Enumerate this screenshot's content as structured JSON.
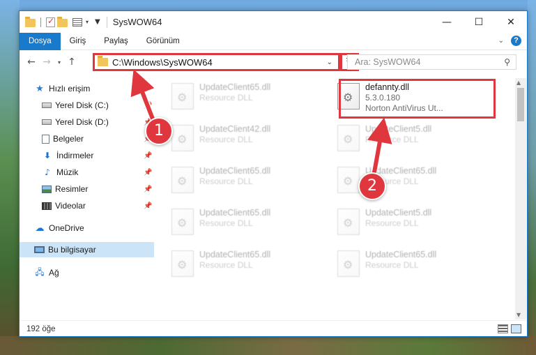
{
  "window": {
    "title": "SysWOW64",
    "controls": {
      "minimize": "—",
      "maximize": "☐",
      "close": "✕"
    }
  },
  "ribbon": {
    "tabs": [
      {
        "label": "Dosya",
        "active": true
      },
      {
        "label": "Giriş"
      },
      {
        "label": "Paylaş"
      },
      {
        "label": "Görünüm"
      }
    ],
    "help": "?"
  },
  "navigation": {
    "address": "C:\\Windows\\SysWOW64",
    "search_placeholder": "Ara: SysWOW64"
  },
  "sidebar": {
    "items": [
      {
        "label": "Hızlı erişim",
        "icon": "star-icon"
      },
      {
        "label": "Yerel Disk (C:)",
        "icon": "drive-icon",
        "pinned": true
      },
      {
        "label": "Yerel Disk (D:)",
        "icon": "drive-icon",
        "pinned": true
      },
      {
        "label": "Belgeler",
        "icon": "documents-icon",
        "pinned": true
      },
      {
        "label": "İndirmeler",
        "icon": "download-icon",
        "pinned": true
      },
      {
        "label": "Müzik",
        "icon": "music-icon",
        "pinned": true
      },
      {
        "label": "Resimler",
        "icon": "pictures-icon",
        "pinned": true
      },
      {
        "label": "Videolar",
        "icon": "videos-icon",
        "pinned": true
      },
      {
        "label": "OneDrive",
        "icon": "cloud-icon"
      },
      {
        "label": "Bu bilgisayar",
        "icon": "computer-icon",
        "selected": true
      },
      {
        "label": "Ağ",
        "icon": "network-icon"
      }
    ]
  },
  "files": [
    {
      "name": "UpdateClient65.dll",
      "sub": "Resource DLL",
      "faded": true
    },
    {
      "name": "defannty.dll",
      "version": "5.3.0.180",
      "description": "Norton AntiVirus Ut...",
      "faded": false
    },
    {
      "name": "UpdateClient42.dll",
      "sub": "Resource DLL",
      "faded": true
    },
    {
      "name": "UpdateClient5.dll",
      "sub": "Resource DLL",
      "faded": true
    },
    {
      "name": "UpdateClient65.dll",
      "sub": "Resource DLL",
      "faded": true
    },
    {
      "name": "UpdateClient65.dll",
      "sub": "Resource DLL",
      "faded": true
    },
    {
      "name": "UpdateClient65.dll",
      "sub": "Resource DLL",
      "faded": true
    },
    {
      "name": "UpdateClient5.dll",
      "sub": "Resource DLL",
      "faded": true
    },
    {
      "name": "UpdateClient65.dll",
      "sub": "Resource DLL",
      "faded": true
    },
    {
      "name": "UpdateClient65.dll",
      "sub": "Resource DLL",
      "faded": true
    }
  ],
  "status": {
    "item_count": "192 öğe"
  },
  "annotations": {
    "step1": "1",
    "step2": "2",
    "accent": "#e0363e"
  }
}
